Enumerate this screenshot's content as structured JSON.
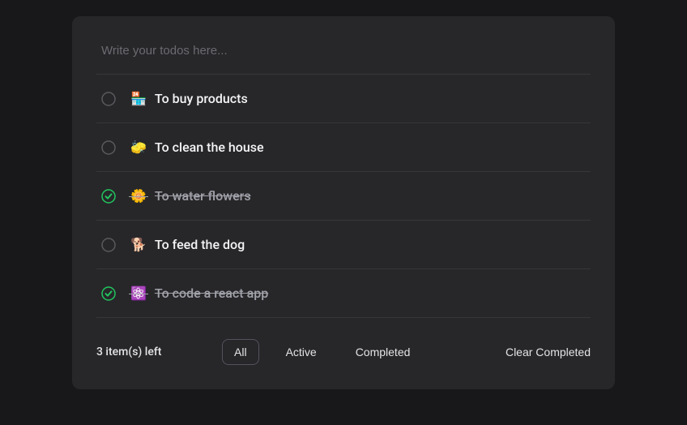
{
  "input": {
    "placeholder": "Write your todos here...",
    "value": ""
  },
  "todos": [
    {
      "emoji": "🏪",
      "label": "To buy products",
      "completed": false
    },
    {
      "emoji": "🧽",
      "label": "To clean the house",
      "completed": false
    },
    {
      "emoji": "🌼",
      "label": "To water flowers",
      "completed": true
    },
    {
      "emoji": "🐕",
      "label": "To feed the dog",
      "completed": false
    },
    {
      "emoji": "⚛️",
      "label": "To code a react app",
      "completed": true
    }
  ],
  "footer": {
    "items_left": "3 item(s) left",
    "filters": {
      "all": "All",
      "active": "Active",
      "completed": "Completed",
      "selected": "all"
    },
    "clear": "Clear Completed"
  }
}
